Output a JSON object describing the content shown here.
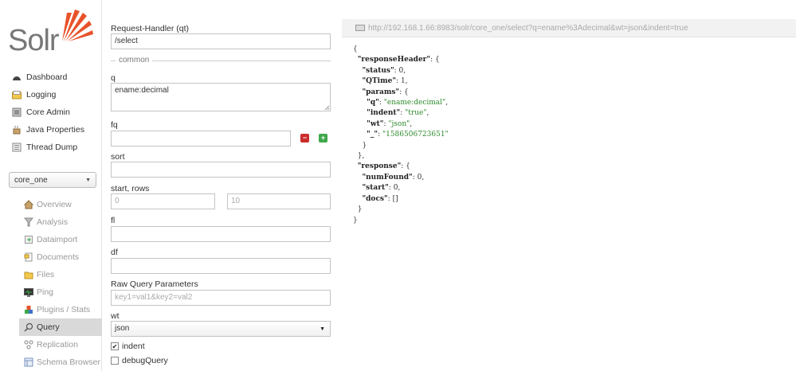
{
  "logo": {
    "text": "Solr"
  },
  "nav": {
    "main": [
      {
        "label": "Dashboard",
        "icon": "dashboard-icon"
      },
      {
        "label": "Logging",
        "icon": "logging-icon"
      },
      {
        "label": "Core Admin",
        "icon": "core-admin-icon"
      },
      {
        "label": "Java Properties",
        "icon": "java-properties-icon"
      },
      {
        "label": "Thread Dump",
        "icon": "thread-dump-icon"
      }
    ],
    "core_selector": "core_one",
    "core": [
      {
        "label": "Overview",
        "icon": "overview-icon"
      },
      {
        "label": "Analysis",
        "icon": "analysis-icon"
      },
      {
        "label": "Dataimport",
        "icon": "dataimport-icon"
      },
      {
        "label": "Documents",
        "icon": "documents-icon"
      },
      {
        "label": "Files",
        "icon": "files-icon"
      },
      {
        "label": "Ping",
        "icon": "ping-icon"
      },
      {
        "label": "Plugins / Stats",
        "icon": "plugins-icon"
      },
      {
        "label": "Query",
        "icon": "query-icon",
        "active": true
      },
      {
        "label": "Replication",
        "icon": "replication-icon"
      },
      {
        "label": "Schema Browser",
        "icon": "schema-browser-icon"
      }
    ]
  },
  "form": {
    "qt_label": "Request-Handler (qt)",
    "qt_value": "/select",
    "common_legend": "common",
    "q_label": "q",
    "q_value": "ename:decimal",
    "fq_label": "fq",
    "fq_value": "",
    "sort_label": "sort",
    "sort_value": "",
    "start_rows_label": "start, rows",
    "start_value": "0",
    "rows_value": "10",
    "fl_label": "fl",
    "fl_value": "",
    "df_label": "df",
    "df_value": "",
    "raw_label": "Raw Query Parameters",
    "raw_placeholder": "key1=val1&key2=val2",
    "wt_label": "wt",
    "wt_value": "json",
    "indent_label": "indent",
    "indent_checked": true,
    "debug_label": "debugQuery",
    "debug_checked": false
  },
  "result": {
    "url": "http://192.168.1.66:8983/solr/core_one/select?q=ename%3Adecimal&wt=json&indent=true",
    "lines": [
      {
        "indent": 0,
        "text": "{"
      },
      {
        "indent": 1,
        "key": "responseHeader",
        "text": ": {"
      },
      {
        "indent": 2,
        "key": "status",
        "text": ": 0,"
      },
      {
        "indent": 2,
        "key": "QTime",
        "text": ": 1,"
      },
      {
        "indent": 2,
        "key": "params",
        "text": ": {"
      },
      {
        "indent": 3,
        "key": "q",
        "text": ": ",
        "str": "\"ename:decimal\"",
        "tail": ","
      },
      {
        "indent": 3,
        "key": "indent",
        "text": ": ",
        "str": "\"true\"",
        "tail": ","
      },
      {
        "indent": 3,
        "key": "wt",
        "text": ": ",
        "str": "\"json\"",
        "tail": ","
      },
      {
        "indent": 3,
        "key": "_",
        "text": ": ",
        "str": "\"1586506723651\"",
        "tail": ""
      },
      {
        "indent": 2,
        "text": "}"
      },
      {
        "indent": 1,
        "text": "},"
      },
      {
        "indent": 1,
        "key": "response",
        "text": ": {"
      },
      {
        "indent": 2,
        "key": "numFound",
        "text": ": 0,"
      },
      {
        "indent": 2,
        "key": "start",
        "text": ": 0,"
      },
      {
        "indent": 2,
        "key": "docs",
        "text": ": []"
      },
      {
        "indent": 1,
        "text": "}"
      },
      {
        "indent": 0,
        "text": "}"
      }
    ]
  },
  "colors": {
    "logo_orange": "#e8522a",
    "remove_red": "#cc2d2d",
    "add_green": "#3fa84a",
    "json_string": "#2d8a2d"
  }
}
